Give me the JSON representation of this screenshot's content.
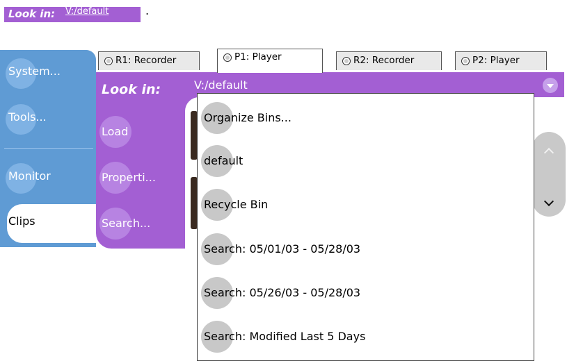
{
  "caption": {
    "label": "Look in:",
    "value": "V:/default",
    "dot": "."
  },
  "sidebar": {
    "items": [
      {
        "label": "System..."
      },
      {
        "label": "Tools..."
      },
      {
        "label": "Monitor"
      },
      {
        "label": "Clips",
        "selected": true
      }
    ]
  },
  "tabs": [
    {
      "label": "R1: Recorder"
    },
    {
      "label": "P1: Player",
      "active": true
    },
    {
      "label": "R2: Recorder"
    },
    {
      "label": "P2: Player"
    }
  ],
  "panel": {
    "look_in_label": "Look in:",
    "path_value": "V:/default",
    "buttons": [
      {
        "label": "Load"
      },
      {
        "label": "Properti..."
      },
      {
        "label": "Search..."
      }
    ]
  },
  "dropdown": {
    "items": [
      {
        "label": "Organize Bins..."
      },
      {
        "label": "default"
      },
      {
        "label": "Recycle Bin"
      },
      {
        "label": "Search: 05/01/03 - 05/28/03"
      },
      {
        "label": "Search: 05/26/03 - 05/28/03"
      },
      {
        "label": "Search: Modified Last 5 Days"
      }
    ]
  },
  "colors": {
    "purple": "#a35fd3",
    "blue": "#5f9bd4",
    "grey": "#c8c8c8"
  },
  "icons": {
    "combo": "chevron-down-icon",
    "scroll_up": "chevron-up-icon",
    "scroll_down": "chevron-down-icon"
  }
}
